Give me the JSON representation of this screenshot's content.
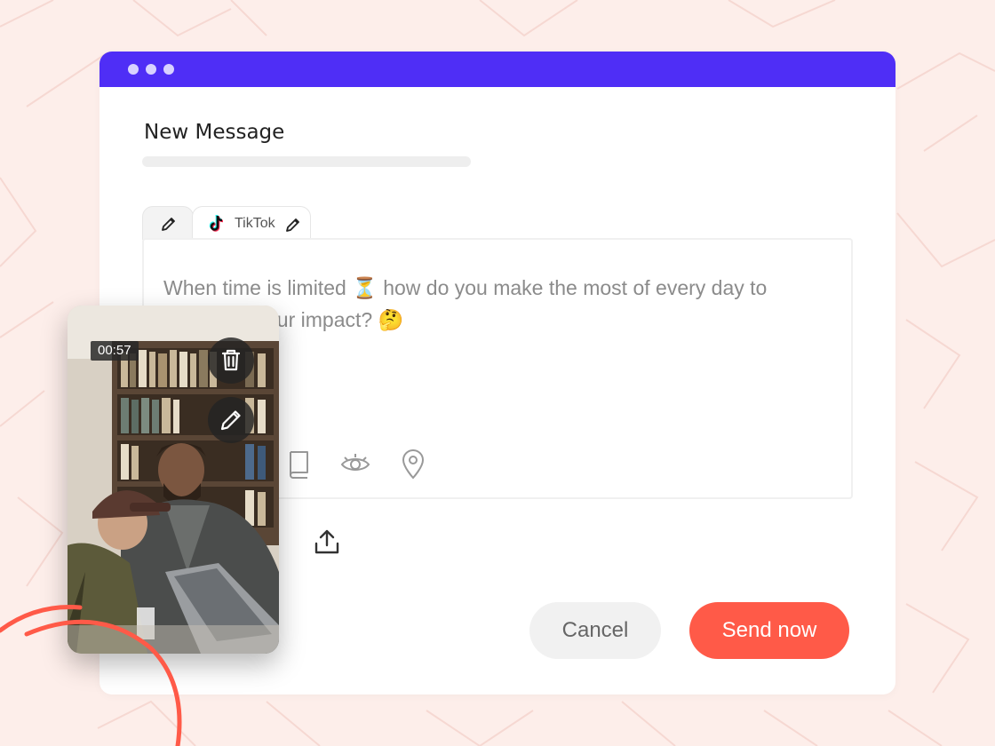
{
  "compose": {
    "title": "New Message",
    "message": "When time is limited ⏳ how do you make the most of every day to maximize your impact? 🤔"
  },
  "tabs": [
    {
      "label": ""
    },
    {
      "label": "TikTok"
    }
  ],
  "buttons": {
    "cancel": "Cancel",
    "send": "Send now"
  },
  "media": {
    "duration": "00:57"
  },
  "colors": {
    "titlebar": "#4f2ef6",
    "send_button": "#ff5a48",
    "background": "#fdeeea"
  },
  "icons": [
    "pencil-icon",
    "tiktok-icon",
    "book-icon",
    "eye-icon",
    "location-pin-icon",
    "upload-icon",
    "trash-icon"
  ]
}
